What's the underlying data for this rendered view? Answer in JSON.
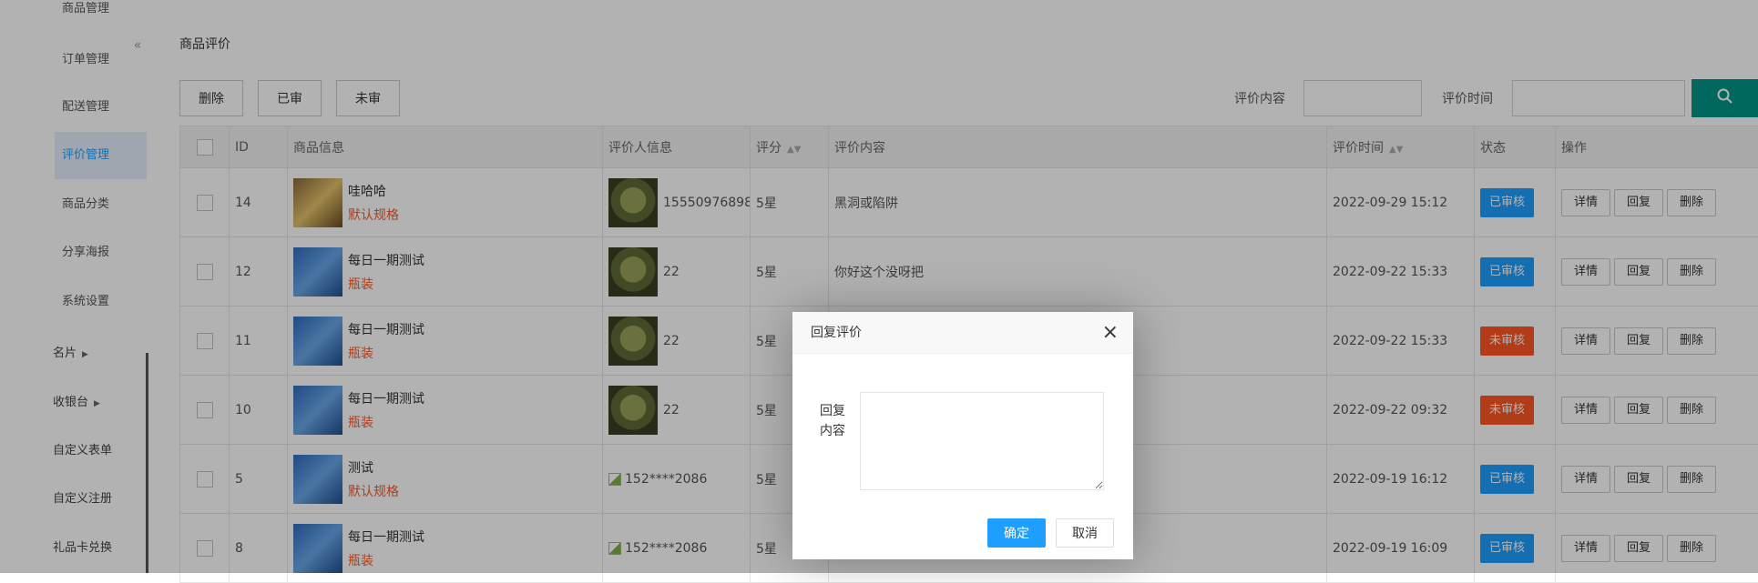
{
  "sidebar": {
    "sub_items": [
      {
        "label": "商品管理"
      },
      {
        "label": "订单管理"
      },
      {
        "label": "配送管理"
      },
      {
        "label": "评价管理"
      },
      {
        "label": "商品分类"
      },
      {
        "label": "分享海报"
      },
      {
        "label": "系统设置"
      }
    ],
    "main_items": [
      {
        "label": "名片"
      },
      {
        "label": "收银台"
      },
      {
        "label": "自定义表单"
      },
      {
        "label": "自定义注册"
      },
      {
        "label": "礼品卡兑换"
      }
    ],
    "collapse_icon": "«"
  },
  "page": {
    "title": "商品评价",
    "toolbar": {
      "delete": "删除",
      "approved": "已审",
      "unapproved": "未审"
    },
    "filters": {
      "content_label": "评价内容",
      "time_label": "评价时间"
    },
    "search_icon": "search-icon"
  },
  "table": {
    "headers": {
      "id": "ID",
      "product": "商品信息",
      "reviewer": "评价人信息",
      "score": "评分",
      "content": "评价内容",
      "time": "评价时间",
      "status": "状态",
      "ops": "操作"
    },
    "ops": {
      "detail": "详情",
      "reply": "回复",
      "delete": "删除"
    },
    "rows": [
      {
        "id": "14",
        "product_name": "哇哈哈",
        "spec": "默认规格",
        "reviewer": "15550976898",
        "score": "5星",
        "content": "黑洞或陷阱",
        "time": "2022-09-29 15:12",
        "status": "已审核",
        "status_color": "#1E9FFF"
      },
      {
        "id": "12",
        "product_name": "每日一期测试",
        "spec": "瓶装",
        "reviewer": "22",
        "score": "5星",
        "content": "你好这个没呀把",
        "time": "2022-09-22 15:33",
        "status": "已审核",
        "status_color": "#1E9FFF"
      },
      {
        "id": "11",
        "product_name": "每日一期测试",
        "spec": "瓶装",
        "reviewer": "22",
        "score": "5星",
        "content": "",
        "time": "2022-09-22 15:33",
        "status": "未审核",
        "status_color": "#FF5722"
      },
      {
        "id": "10",
        "product_name": "每日一期测试",
        "spec": "瓶装",
        "reviewer": "22",
        "score": "5星",
        "content": "",
        "time": "2022-09-22 09:32",
        "status": "未审核",
        "status_color": "#FF5722"
      },
      {
        "id": "5",
        "product_name": "测试",
        "spec": "默认规格",
        "reviewer": "152****2086",
        "score": "5星",
        "content": "",
        "time": "2022-09-19 16:12",
        "status": "已审核",
        "status_color": "#1E9FFF"
      },
      {
        "id": "8",
        "product_name": "每日一期测试",
        "spec": "瓶装",
        "reviewer": "152****2086",
        "score": "5星",
        "content": "",
        "time": "2022-09-19 16:09",
        "status": "已审核",
        "status_color": "#1E9FFF"
      }
    ]
  },
  "dialog": {
    "title": "回复评价",
    "close_icon": "×",
    "label": "回复内容",
    "textarea_value": "",
    "confirm": "确定",
    "cancel": "取消"
  }
}
